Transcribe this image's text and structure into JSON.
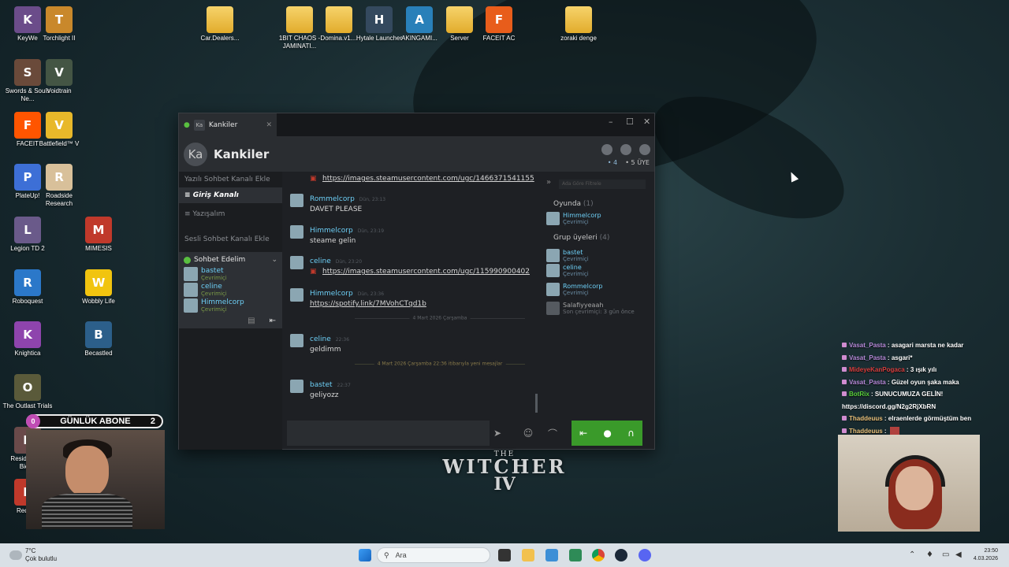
{
  "desktop": {
    "icons": [
      {
        "label": "KeyWe",
        "glyph": "K",
        "color": "#6b4c8a"
      },
      {
        "label": "Torchlight II",
        "glyph": "T",
        "color": "#c9882b"
      },
      {
        "label": "Swords & Souls Ne...",
        "glyph": "S",
        "color": "#6a4a3a"
      },
      {
        "label": "Voidtrain",
        "glyph": "V",
        "color": "#445544"
      },
      {
        "label": "FACEIT",
        "glyph": "F",
        "color": "#ff5500"
      },
      {
        "label": "Battlefield™ V",
        "glyph": "V",
        "color": "#e8b82a"
      },
      {
        "label": "PlateUp!",
        "glyph": "P",
        "color": "#3d6fd6"
      },
      {
        "label": "Roadside Research",
        "glyph": "R",
        "color": "#d8c09a"
      },
      {
        "label": "Legion TD 2",
        "glyph": "L",
        "color": "#6a5a8a"
      },
      {
        "label": "MIMESIS",
        "glyph": "M",
        "color": "#c0392b"
      },
      {
        "label": "Roboquest",
        "glyph": "R",
        "color": "#2b78c9"
      },
      {
        "label": "Wobbly Life",
        "glyph": "W",
        "color": "#f1c40f"
      },
      {
        "label": "Knightica",
        "glyph": "K",
        "color": "#8e44ad"
      },
      {
        "label": "Becastled",
        "glyph": "B",
        "color": "#2c5f8a"
      },
      {
        "label": "The Outlast Trials",
        "glyph": "O",
        "color": "#5a5a3a"
      },
      {
        "label": "Resident 7 - Bioha",
        "glyph": "R",
        "color": "#6a4a4a"
      },
      {
        "label": "Redmat",
        "glyph": "R",
        "color": "#c0392b"
      },
      {
        "label": "Car.Dealers...",
        "glyph": "",
        "color": "folder"
      },
      {
        "label": "1BIT CHAOS - JAMINATI...",
        "glyph": "",
        "color": "folder"
      },
      {
        "label": "Domina.v1....",
        "glyph": "",
        "color": "folder"
      },
      {
        "label": "Hytale Launcher",
        "glyph": "H",
        "color": "#34495e"
      },
      {
        "label": "AKINGAMI...",
        "glyph": "A",
        "color": "#2980b9"
      },
      {
        "label": "Server",
        "glyph": "",
        "color": "folder"
      },
      {
        "label": "FACEIT AC",
        "glyph": "F",
        "color": "#e85d1b"
      },
      {
        "label": "zoraki denge",
        "glyph": "",
        "color": "folder"
      }
    ]
  },
  "steam_chat": {
    "tab_label": "Kankiler",
    "tab_avatar": "Ka",
    "group_name": "Kankiler",
    "group_avatar": "Ka",
    "online_count": "• 4",
    "member_count": "• 5 ÜYE",
    "sidebar": {
      "add_text_channel": "Yazılı Sohbet Kanalı Ekle",
      "channels": [
        "Giriş Kanalı",
        "Yazışalım"
      ],
      "add_voice_channel": "Sesli Sohbet Kanalı Ekle",
      "voice_channel": "Sohbet Edelim",
      "voice_users": [
        {
          "name": "bastet",
          "status": "Çevrimiçi"
        },
        {
          "name": "celine",
          "status": "Çevrimiçi"
        },
        {
          "name": "Himmelcorp",
          "status": "Çevrimiçi"
        }
      ]
    },
    "messages": [
      {
        "type": "link",
        "text": "https://images.steamusercontent.com/ugc/1466371541155"
      },
      {
        "type": "msg",
        "author": "Rommelcorp",
        "time": "Dün, 23:13",
        "text": "DAVET PLEASE",
        "color": "#6dcff6"
      },
      {
        "type": "msg",
        "author": "Himmelcorp",
        "time": "Dün, 23:19",
        "text": "steame gelin",
        "color": "#6dcff6"
      },
      {
        "type": "msg",
        "author": "celine",
        "time": "Dün, 23:20",
        "text": "https://images.steamusercontent.com/ugc/115990900402",
        "link": true,
        "color": "#6dcff6"
      },
      {
        "type": "msg",
        "author": "Himmelcorp",
        "time": "Dün, 23:36",
        "text": "https://spotify.link/7MVohCTqd1b",
        "link": true,
        "color": "#6dcff6"
      },
      {
        "type": "sep",
        "text": "4 Mart 2026 Çarşamba"
      },
      {
        "type": "msg",
        "author": "celine",
        "time": "22:36",
        "text": "geldimm",
        "color": "#6dcff6"
      },
      {
        "type": "sep",
        "text": "4 Mart 2026 Çarşamba 22:36 itibarıyla yeni mesajlar"
      },
      {
        "type": "msg",
        "author": "bastet",
        "time": "22:37",
        "text": "geliyozz",
        "color": "#6dcff6"
      }
    ],
    "members": {
      "filter_placeholder": "Ada Göre Filtrele",
      "ingame_header": "Oyunda",
      "ingame_count": "(1)",
      "ingame": [
        {
          "name": "Himmelcorp",
          "status": "Çevrimiçi"
        }
      ],
      "group_header": "Grup üyeleri",
      "group_count": "(4)",
      "group": [
        {
          "name": "bastet",
          "status": "Çevrimiçi",
          "off": false
        },
        {
          "name": "celine",
          "status": "Çevrimiçi",
          "off": false
        },
        {
          "name": "Rommelcorp",
          "status": "Çevrimiçi",
          "off": false
        },
        {
          "name": "Salafiyyeaah",
          "status": "Son çevrimiçi: 3 gün önce",
          "off": true
        }
      ]
    }
  },
  "stream": {
    "abone_left": "0",
    "abone_label": "GÜNLÜK ABONE",
    "abone_right": "2",
    "chat": [
      {
        "user": "Vasat_Pasta",
        "text": "asagari marsta ne kadar",
        "ucls": "u"
      },
      {
        "user": "Vasat_Pasta",
        "text": "asgari*",
        "ucls": "u"
      },
      {
        "user": "MideyeKanPogaca",
        "text": "3 ışık yılı",
        "ucls": "u2"
      },
      {
        "user": "Vasat_Pasta",
        "text": "Güzel oyun şaka maka",
        "ucls": "u"
      },
      {
        "user": "BotRix",
        "text": "SUNUCUMUZA GELİN!",
        "ucls": "u3"
      },
      {
        "user": "",
        "text": "https://discord.gg/N2g2RjXbRN",
        "ucls": "u"
      },
      {
        "user": "Thaddeuus",
        "text": "elraenlerde görmüştüm ben",
        "ucls": "u4"
      },
      {
        "user": "Thaddeuus",
        "text": "",
        "ucls": "u4"
      }
    ]
  },
  "game_logo": {
    "the": "THE",
    "title": "WITCHER",
    "num": "IV"
  },
  "taskbar": {
    "temp": "7°C",
    "weather": "Çok bulutlu",
    "search_placeholder": "Ara",
    "time": "23:50",
    "date": "4.03.2026"
  }
}
